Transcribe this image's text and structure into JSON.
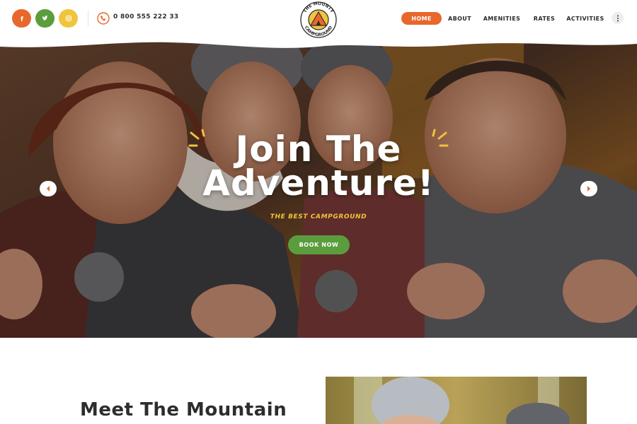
{
  "header": {
    "social": [
      {
        "name": "facebook-icon",
        "glyph": "f",
        "color": "#e8672c"
      },
      {
        "name": "twitter-icon",
        "color": "#5b9d3d"
      },
      {
        "name": "instagram-icon",
        "color": "#f0c43d"
      }
    ],
    "phone": "0 800 555 222 33",
    "logo": {
      "top_text": "THE MOUNTY",
      "bottom_text": "CAMPGROUND"
    },
    "nav": {
      "home": "HOME",
      "about": "ABOUT",
      "amenities": "AMENITIES",
      "rates": "RATES",
      "activities": "ACTIVITIES"
    }
  },
  "hero": {
    "title_line1": "Join The",
    "title_line2": "Adventure!",
    "subtitle": "THE BEST CAMPGROUND",
    "button": "BOOK NOW"
  },
  "section": {
    "heading": "Meet The Mountain"
  },
  "colors": {
    "accent_orange": "#e8672c",
    "accent_green": "#5b9d3d",
    "accent_yellow": "#f0c43d"
  }
}
